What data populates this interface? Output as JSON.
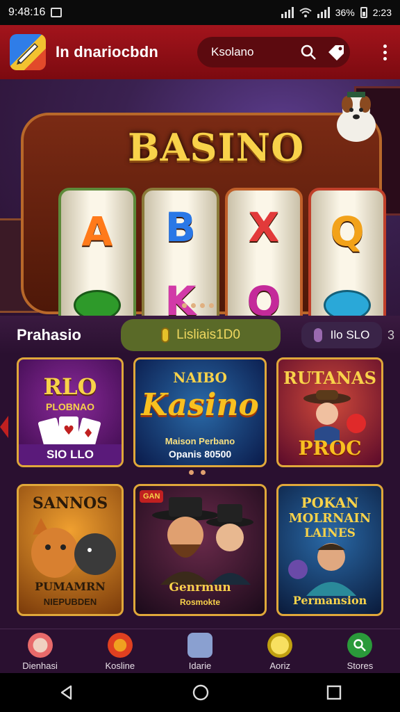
{
  "status": {
    "time": "9:48:16",
    "battery": "36%",
    "right_extra": "2:23"
  },
  "app": {
    "title": "In dnariocbdn",
    "search_label": "Ksolano"
  },
  "hero": {
    "brand": "BASINO",
    "reels": [
      {
        "top": "A",
        "top_color": "#ff7a1a",
        "bottom": "chip",
        "bottom_color": "#2e9a2a"
      },
      {
        "top": "B",
        "top_color": "#2a78e6",
        "bottom": "K",
        "bottom_color": "#d23aa8"
      },
      {
        "top": "X",
        "top_color": "#e23a3a",
        "bottom": "Q",
        "bottom_color": "#c42a9a"
      },
      {
        "top": "Q",
        "top_color": "#f2a21a",
        "bottom": "chip",
        "bottom_color": "#2aa8d8"
      }
    ]
  },
  "tabs": {
    "t0": "Prahasio",
    "t1": "Lisliais1D0",
    "t2": "Ilo SLO",
    "t3": "3"
  },
  "cards": {
    "c1": {
      "top": "RLO",
      "mid": "PLOBNAO",
      "bottom": "SIO LLO"
    },
    "c2": {
      "top": "NAIBO",
      "big": "Kasino",
      "sub1": "Maison Perbano",
      "sub2": "Opanis 80500"
    },
    "c3": {
      "top": "RUTANAS",
      "bottom": "PROC"
    },
    "c4": {
      "top": "SANNOS",
      "bottom1": "PUMAMRN",
      "bottom2": "NIEPUBDEN"
    },
    "c5": {
      "badge": "GAN",
      "bottom1": "Genrmun",
      "bottom2": "Rosmokte"
    },
    "c6": {
      "top1": "POKAN",
      "top2": "MOLRNAIN",
      "top3": "LAINES",
      "bottom": "Permansion"
    }
  },
  "nav": [
    {
      "label": "Dienhasi",
      "icon": "cat-face-icon",
      "color": "#e86a6a"
    },
    {
      "label": "Kosline",
      "icon": "helmet-icon",
      "color": "#e04020"
    },
    {
      "label": "Idarie",
      "icon": "document-icon",
      "color": "#8aa0d0"
    },
    {
      "label": "Aoriz",
      "icon": "lemon-icon",
      "color": "#e0c020"
    },
    {
      "label": "Stores",
      "icon": "search-circle-icon",
      "color": "#2a9a3a"
    }
  ]
}
